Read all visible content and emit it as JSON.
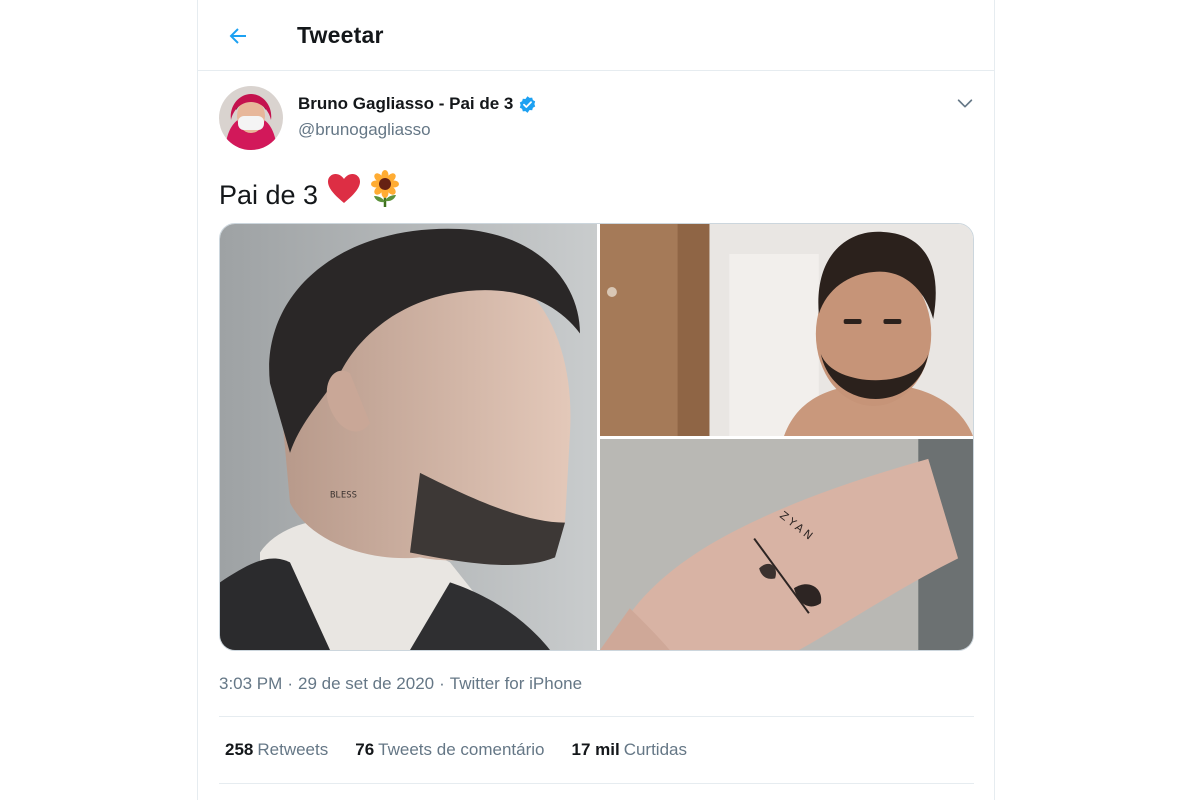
{
  "header": {
    "title": "Tweetar",
    "back_icon": "arrow-left-icon"
  },
  "tweet": {
    "author_name": "Bruno Gagliasso - Pai de 3",
    "handle": "@brunogagliasso",
    "verified": true,
    "text": "Pai de 3",
    "emojis": [
      "red-heart-icon",
      "sunflower-icon"
    ],
    "time": "3:03 PM",
    "date": "29 de set de 2020",
    "source": "Twitter for iPhone",
    "photo_text": {
      "neck_tattoo": "BLESS",
      "hand_tattoo": "ZYAN"
    }
  },
  "stats": [
    {
      "value": "258",
      "label": "Retweets"
    },
    {
      "value": "76",
      "label": "Tweets de comentário"
    },
    {
      "value": "17 mil",
      "label": "Curtidas"
    }
  ],
  "colors": {
    "accent": "#1da1f2",
    "text_primary": "#14171a",
    "text_secondary": "#657786",
    "border": "#e6ecf0"
  }
}
